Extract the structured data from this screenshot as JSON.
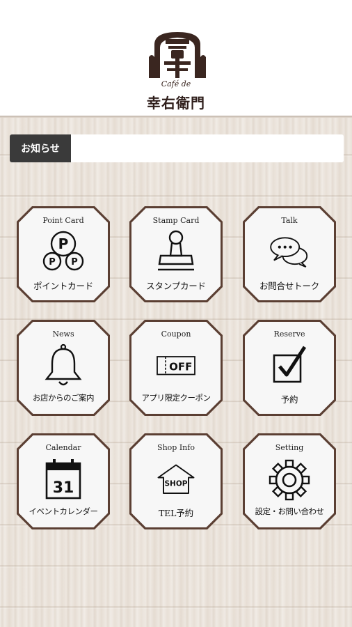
{
  "brand": {
    "script": "Café de",
    "name": "幸右衛門"
  },
  "news": {
    "label": "お知らせ",
    "text": ""
  },
  "menu": [
    {
      "en": "Point Card",
      "jp": "ポイントカード",
      "icon": "point-card-icon"
    },
    {
      "en": "Stamp Card",
      "jp": "スタンプカード",
      "icon": "stamp-icon"
    },
    {
      "en": "Talk",
      "jp": "お問合せトーク",
      "icon": "chat-bubbles-icon"
    },
    {
      "en": "News",
      "jp": "お店からのご案内",
      "icon": "bell-icon"
    },
    {
      "en": "Coupon",
      "jp": "アプリ限定クーポン",
      "icon": "coupon-icon",
      "icon_text": "OFF"
    },
    {
      "en": "Reserve",
      "jp": "予約",
      "icon": "checkbox-icon"
    },
    {
      "en": "Calendar",
      "jp": "イベントカレンダー",
      "icon": "calendar-icon",
      "icon_text": "31"
    },
    {
      "en": "Shop Info",
      "jp": "TEL予約",
      "icon": "shop-icon",
      "icon_text": "SHOP"
    },
    {
      "en": "Setting",
      "jp": "設定・お問い合わせ",
      "icon": "gear-icon"
    }
  ],
  "colors": {
    "tile_border": "#5b3f33",
    "tile_fill": "#f7f7f7",
    "news_label_bg": "#3a3a3a",
    "brand_dark": "#3a2620"
  }
}
